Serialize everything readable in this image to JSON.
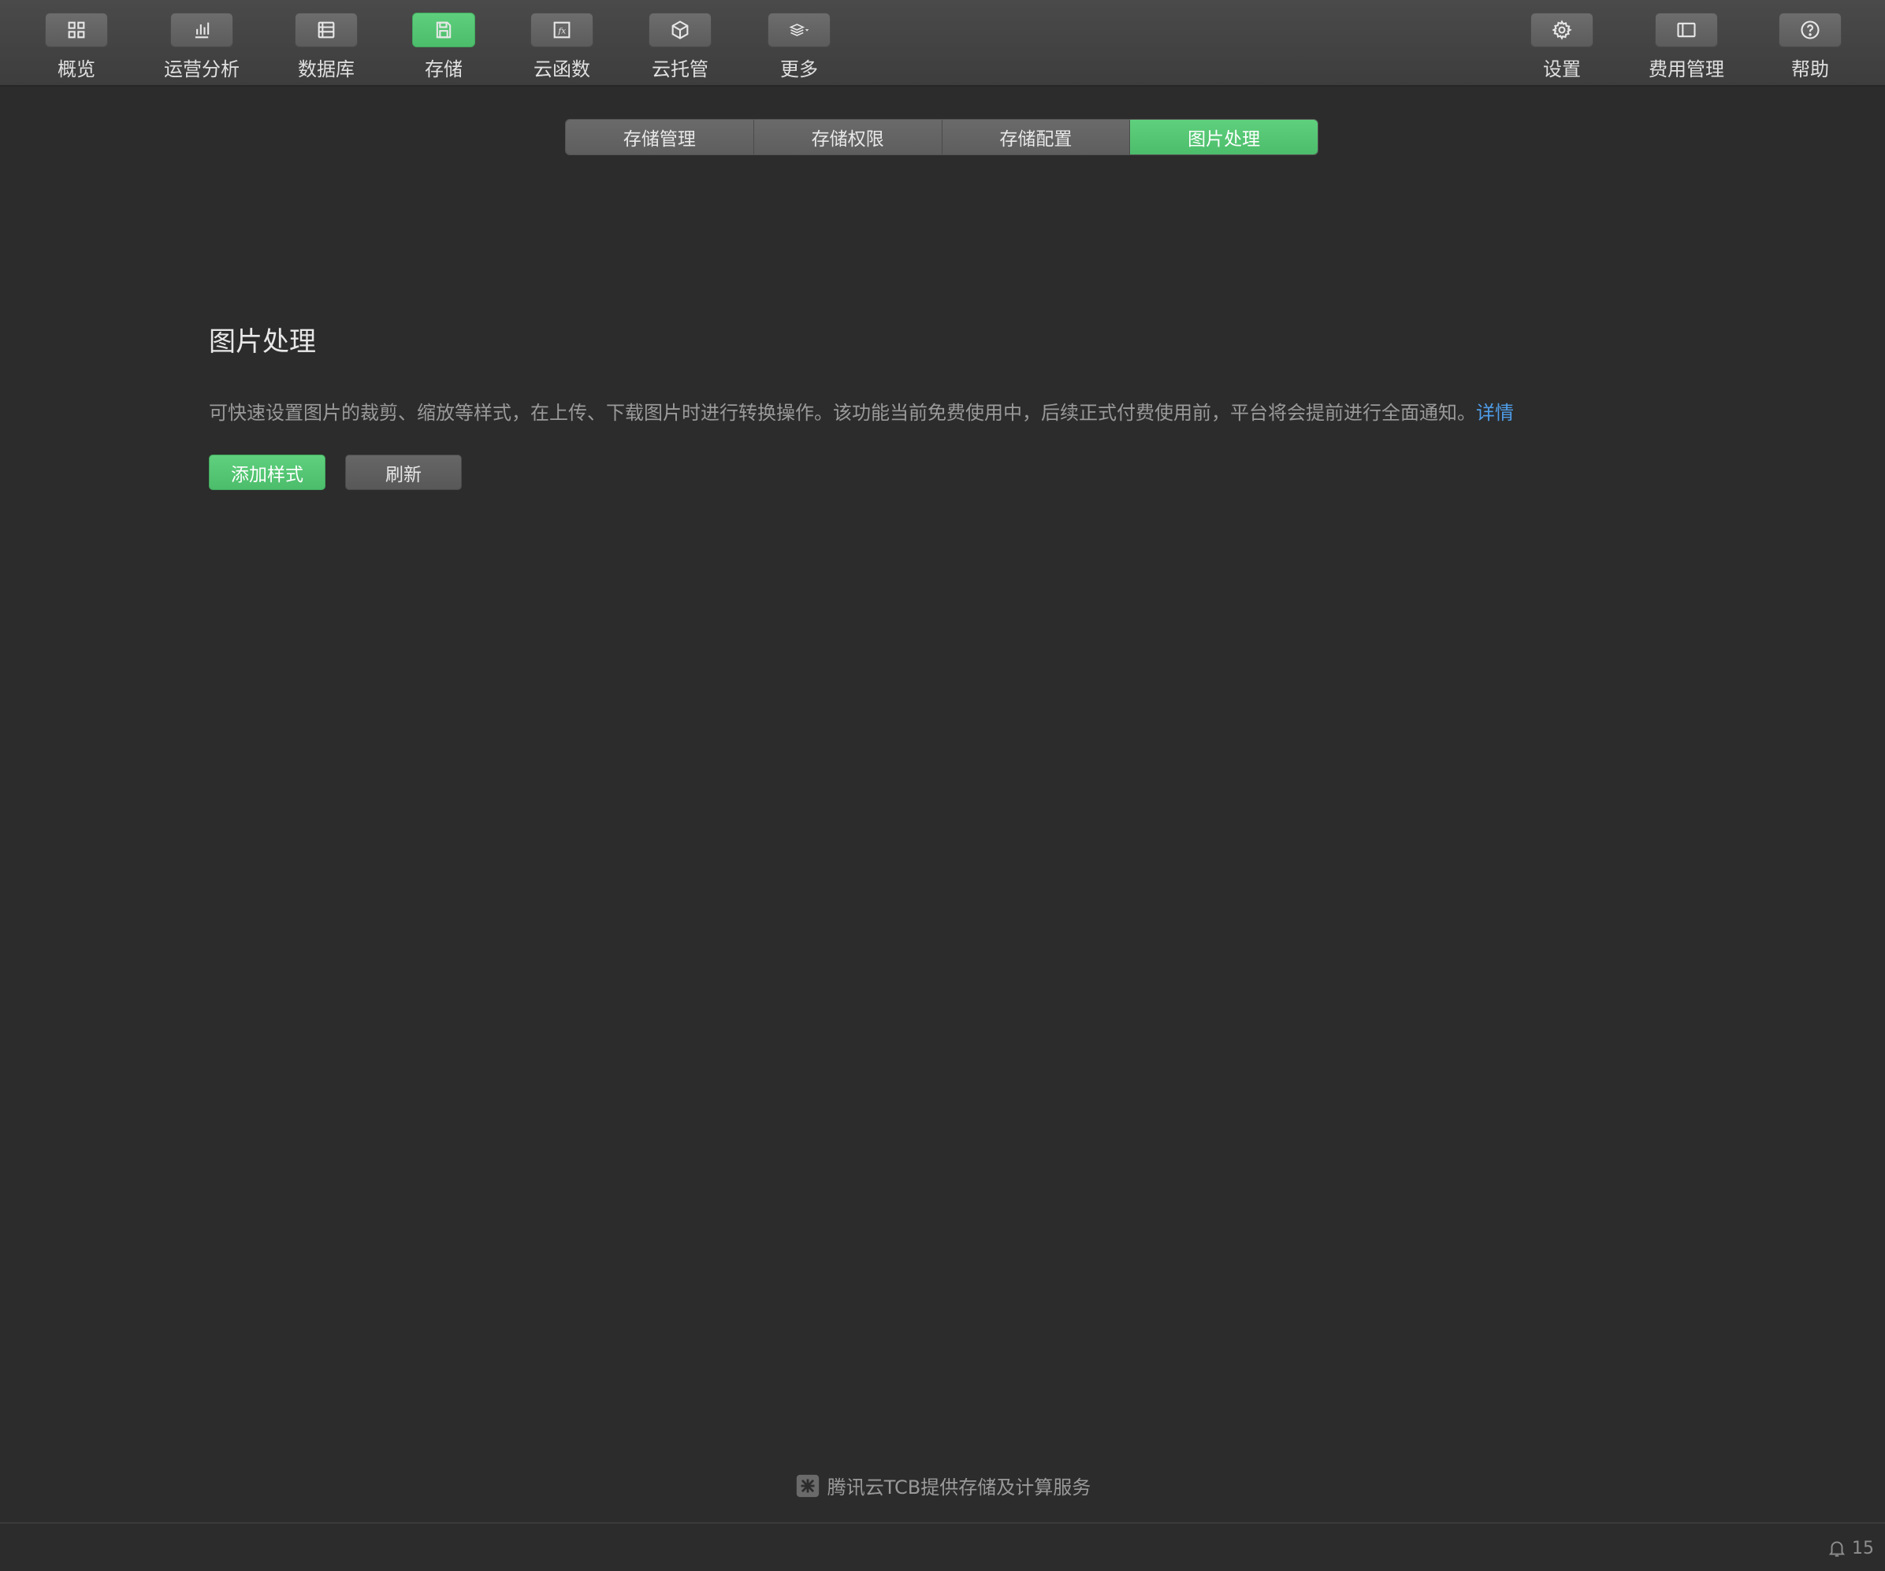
{
  "toolbar": {
    "left_items": [
      {
        "label": "概览",
        "icon": "grid-icon"
      },
      {
        "label": "运营分析",
        "icon": "bar-chart-icon"
      },
      {
        "label": "数据库",
        "icon": "database-icon"
      },
      {
        "label": "存储",
        "icon": "save-icon",
        "active": true
      },
      {
        "label": "云函数",
        "icon": "function-icon"
      },
      {
        "label": "云托管",
        "icon": "cube-icon"
      },
      {
        "label": "更多",
        "icon": "layers-dropdown-icon"
      }
    ],
    "right_items": [
      {
        "label": "设置",
        "icon": "gear-icon"
      },
      {
        "label": "费用管理",
        "icon": "billing-icon"
      },
      {
        "label": "帮助",
        "icon": "help-icon"
      }
    ]
  },
  "tabs": [
    {
      "label": "存储管理"
    },
    {
      "label": "存储权限"
    },
    {
      "label": "存储配置"
    },
    {
      "label": "图片处理",
      "active": true
    }
  ],
  "main": {
    "title": "图片处理",
    "description": "可快速设置图片的裁剪、缩放等样式，在上传、下载图片时进行转换操作。该功能当前免费使用中，后续正式付费使用前，平台将会提前进行全面通知。",
    "details_link": "详情",
    "add_style_button": "添加样式",
    "refresh_button": "刷新"
  },
  "footer": {
    "text": "腾讯云TCB提供存储及计算服务"
  },
  "status": {
    "notification_count": "15"
  },
  "colors": {
    "accent": "#4cbd6b",
    "link": "#4f9de8",
    "background": "#2c2c2c"
  }
}
